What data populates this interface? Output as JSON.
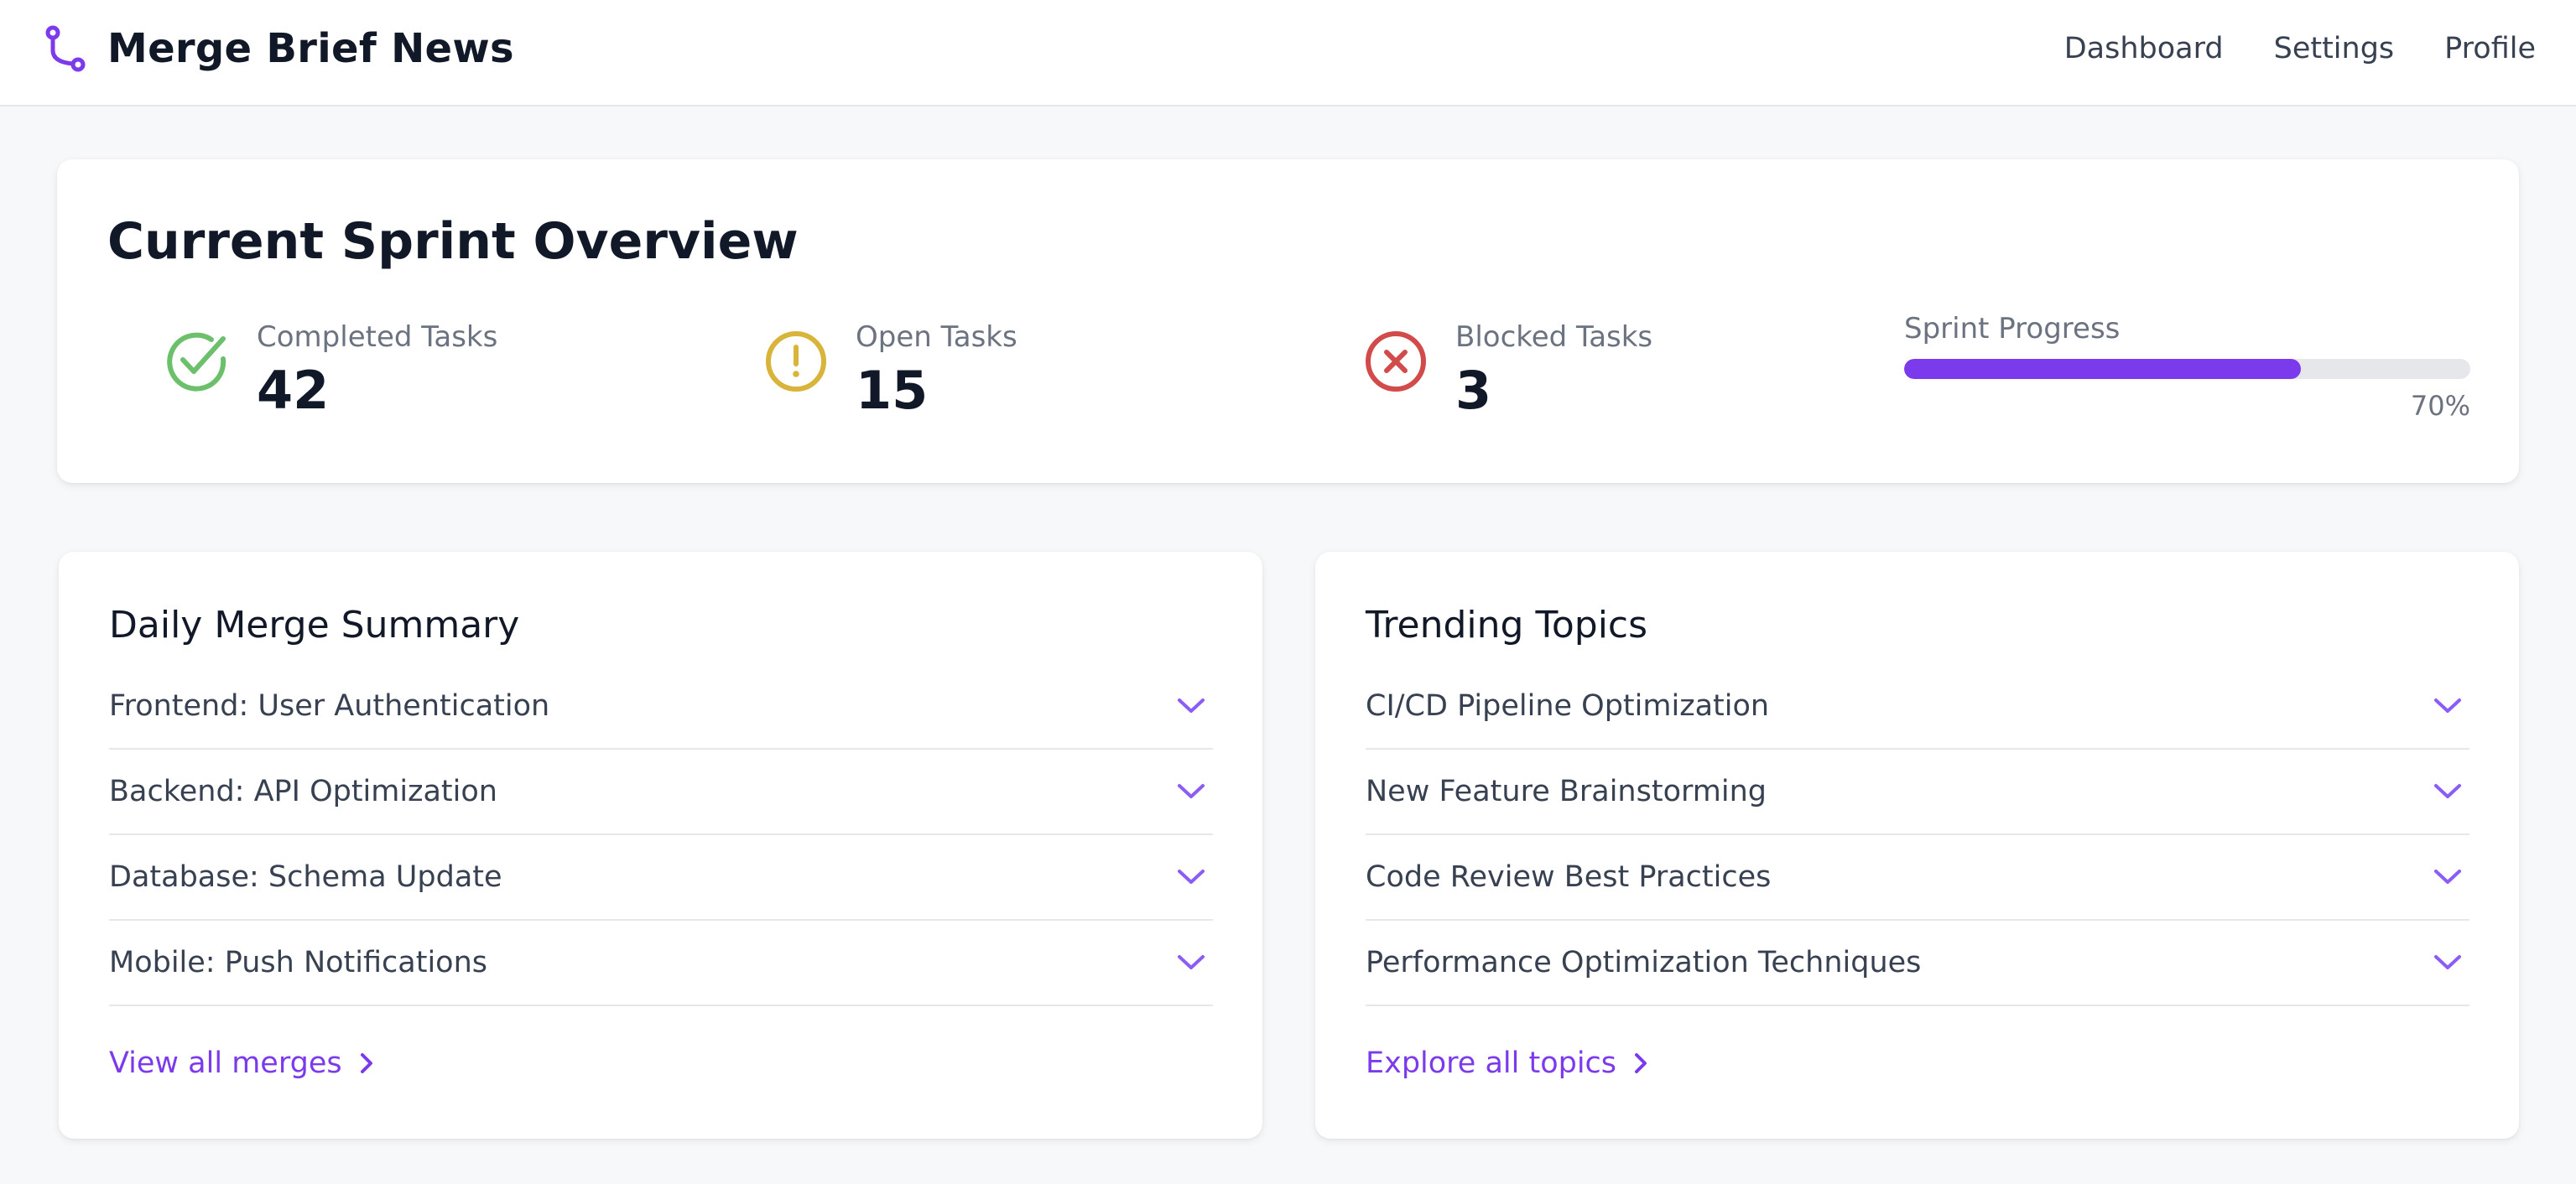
{
  "header": {
    "app_title": "Merge Brief News",
    "logo_icon": "git-merge-icon",
    "nav": [
      "Dashboard",
      "Settings",
      "Profile"
    ]
  },
  "colors": {
    "accent": "#7c3aed",
    "success": "#6cc06c",
    "warning": "#d9b43a",
    "danger": "#d24b4b",
    "progress_track": "#e5e7eb"
  },
  "sprint": {
    "title": "Current Sprint Overview",
    "stats": [
      {
        "label": "Completed Tasks",
        "value": "42",
        "icon": "check-circle-icon"
      },
      {
        "label": "Open Tasks",
        "value": "15",
        "icon": "exclamation-circle-icon"
      },
      {
        "label": "Blocked Tasks",
        "value": "3",
        "icon": "x-circle-icon"
      }
    ],
    "progress": {
      "label": "Sprint Progress",
      "value_percent": 70,
      "text": "70%"
    }
  },
  "merges": {
    "title": "Daily Merge Summary",
    "items": [
      "Frontend: User Authentication",
      "Backend: API Optimization",
      "Database: Schema Update",
      "Mobile: Push Notifications"
    ],
    "link": "View all merges"
  },
  "topics": {
    "title": "Trending Topics",
    "items": [
      "CI/CD Pipeline Optimization",
      "New Feature Brainstorming",
      "Code Review Best Practices",
      "Performance Optimization Techniques"
    ],
    "link": "Explore all topics"
  }
}
